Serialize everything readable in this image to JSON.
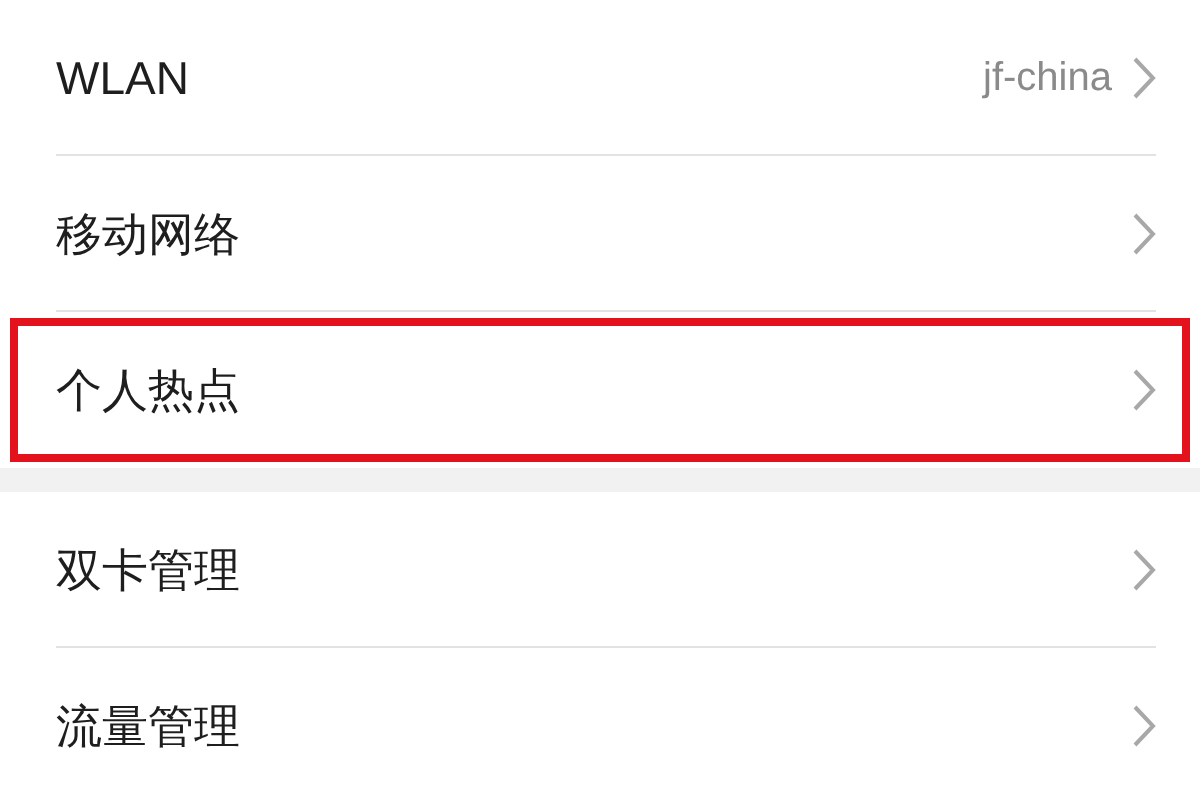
{
  "sections": [
    {
      "items": [
        {
          "label": "WLAN",
          "value": "jf-china",
          "highlighted": false
        },
        {
          "label": "移动网络",
          "highlighted": false
        },
        {
          "label": "个人热点",
          "highlighted": true
        }
      ]
    },
    {
      "items": [
        {
          "label": "双卡管理",
          "highlighted": false
        },
        {
          "label": "流量管理",
          "highlighted": false
        }
      ]
    }
  ]
}
